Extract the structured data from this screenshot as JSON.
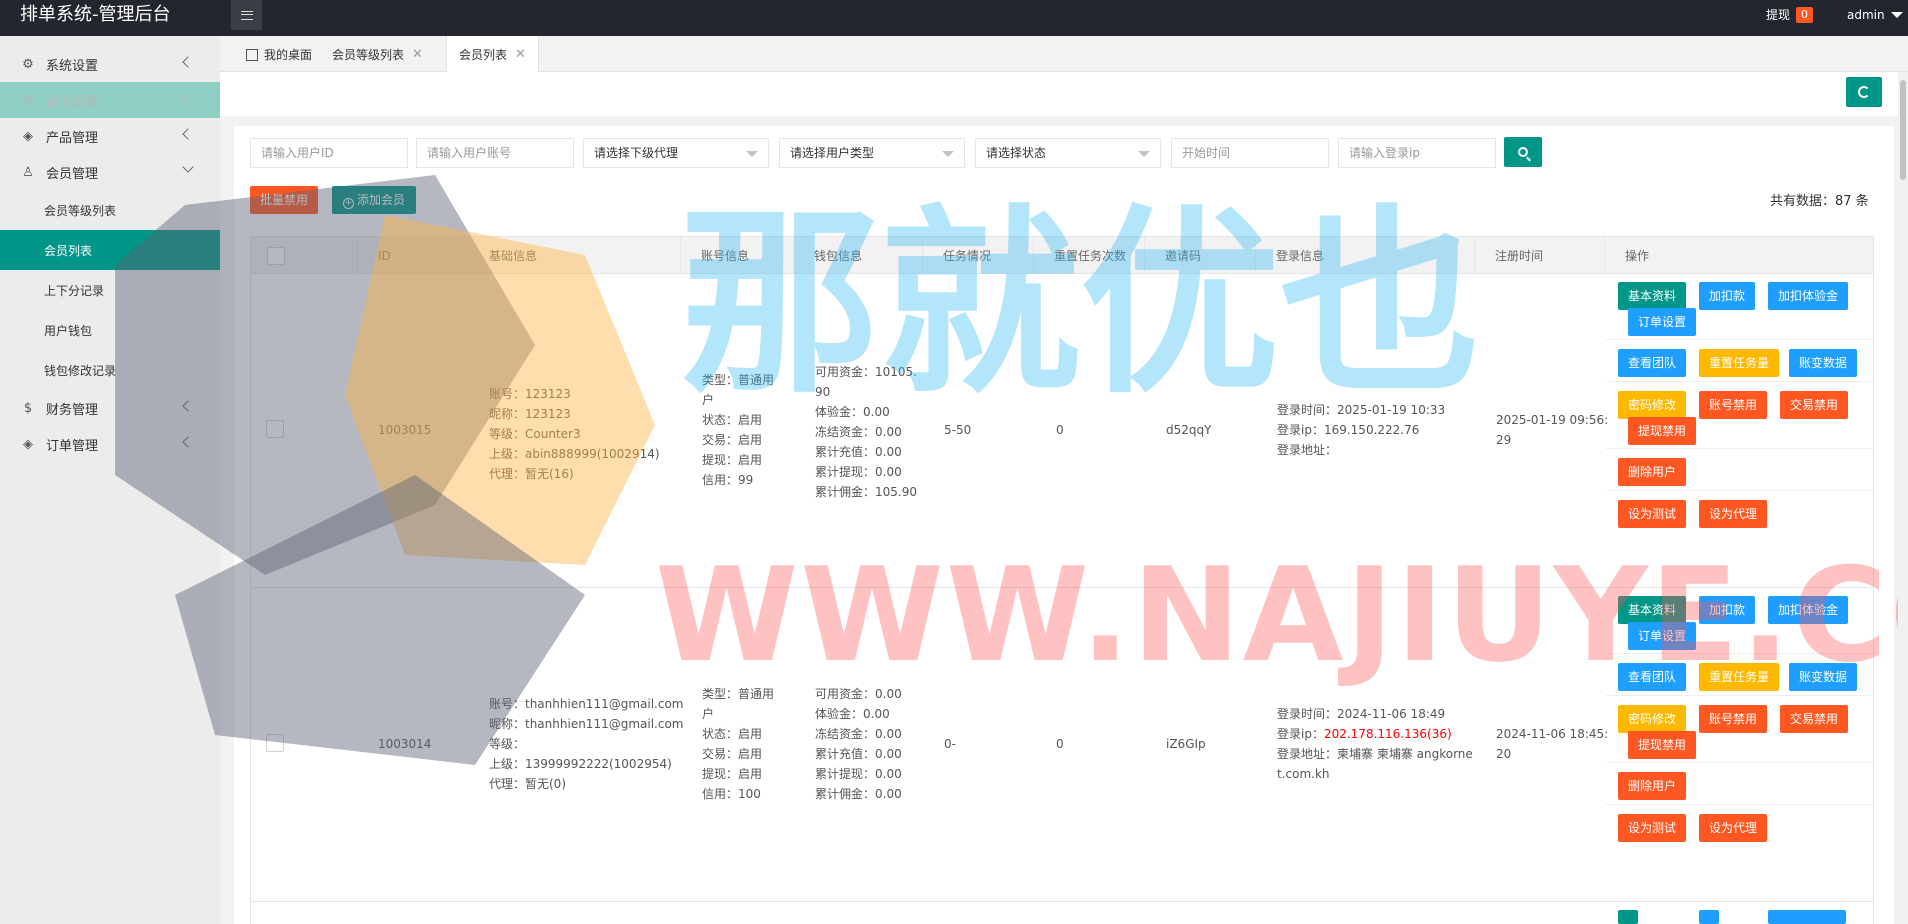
{
  "header": {
    "app_title": "排单系统-管理后台",
    "withdraw_label": "提现",
    "withdraw_count": "0",
    "user": "admin"
  },
  "sidebar": {
    "items": [
      {
        "label": "系统设置",
        "icon": "gear-icon"
      },
      {
        "label": "站点设置",
        "icon": "gear-icon"
      },
      {
        "label": "产品管理",
        "icon": "box-icon"
      },
      {
        "label": "会员管理",
        "icon": "user-icon"
      }
    ],
    "sub_items": [
      "会员等级列表",
      "会员列表",
      "上下分记录",
      "用户钱包",
      "钱包修改记录"
    ],
    "items2": [
      {
        "label": "财务管理",
        "icon": "dollar-icon"
      },
      {
        "label": "订单管理",
        "icon": "box-icon"
      }
    ]
  },
  "tabs": {
    "home": "我的桌面",
    "level_list": "会员等级列表",
    "member_list": "会员列表"
  },
  "filters": {
    "user_id_placeholder": "请输入用户ID",
    "account_placeholder": "请输入用户账号",
    "agent_select": "请选择下级代理",
    "type_select": "请选择用户类型",
    "status_select": "请选择状态",
    "start_time_placeholder": "开始时间",
    "login_ip_placeholder": "请输入登录ip"
  },
  "toolbar": {
    "batch_disable": "批量禁用",
    "add_member": "添加会员",
    "total": "共有数据：87 条"
  },
  "table": {
    "headers": [
      "ID",
      "基础信息",
      "账号信息",
      "钱包信息",
      "任务情况",
      "重置任务次数",
      "邀请码",
      "登录信息",
      "注册时间",
      "操作"
    ],
    "rows": [
      {
        "id": "1003015",
        "basic": [
          "账号：123123",
          "昵称：123123",
          "等级：Counter3",
          "上级：abin888999(1002914)",
          "代理：暂无(16)"
        ],
        "account": [
          "类型：普通用",
          "户",
          "状态：启用",
          "交易：启用",
          "提现：启用",
          "信用：99"
        ],
        "wallet": [
          "可用资金：10105.",
          "90",
          "体验金：0.00",
          "冻结资金：0.00",
          "累计充值：0.00",
          "累计提现：0.00",
          "累计佣金：105.90"
        ],
        "task": "5-50",
        "reset": "0",
        "invite": "d52qqY",
        "login_time": "登录时间：2025-01-19 10:33",
        "login_ip_label": "登录ip：",
        "login_ip": "169.150.222.76",
        "login_addr": [
          "登录地址："
        ],
        "reg_time": [
          "2025-01-19 09:56:",
          "29"
        ]
      },
      {
        "id": "1003014",
        "basic": [
          "账号：thanhhien111@gmail.com",
          "昵称：thanhhien111@gmail.com",
          "等级：",
          "上级：13999992222(1002954)",
          "代理：暂无(0)"
        ],
        "account": [
          "类型：普通用",
          "户",
          "状态：启用",
          "交易：启用",
          "提现：启用",
          "信用：100"
        ],
        "wallet": [
          "可用资金：0.00",
          "体验金：0.00",
          "冻结资金：0.00",
          "累计充值：0.00",
          "累计提现：0.00",
          "累计佣金：0.00"
        ],
        "task": "0-",
        "reset": "0",
        "invite": "iZ6GIp",
        "login_time": "登录时间：2024-11-06 18:49",
        "login_ip_label": "登录ip：",
        "login_ip": "202.178.116.136(36)",
        "login_addr": [
          "登录地址：柬埔寨 柬埔寨 angkorne",
          "t.com.kh"
        ],
        "reg_time": [
          "2024-11-06 18:45:",
          "20"
        ]
      }
    ],
    "actions": {
      "basic_info": "基本资料",
      "add_deduct": "加扣款",
      "add_deduct_trial": "加扣体验金",
      "order_settings": "订单设置",
      "view_team": "查看团队",
      "reset_task": "重置任务量",
      "account_change": "账变数据",
      "password_change": "密码修改",
      "account_disable": "账号禁用",
      "trade_disable": "交易禁用",
      "withdraw_disable": "提现禁用",
      "delete_user": "删除用户",
      "set_test": "设为测试",
      "set_agent": "设为代理"
    }
  },
  "watermark": {
    "url": "WWW.NAJIUYE.COM",
    "cn": "那就优也"
  },
  "colors": {
    "header_bg": "#23262e",
    "accent": "#009688",
    "danger": "#ff5722",
    "info": "#1e9fff",
    "warn": "#ffb800"
  }
}
